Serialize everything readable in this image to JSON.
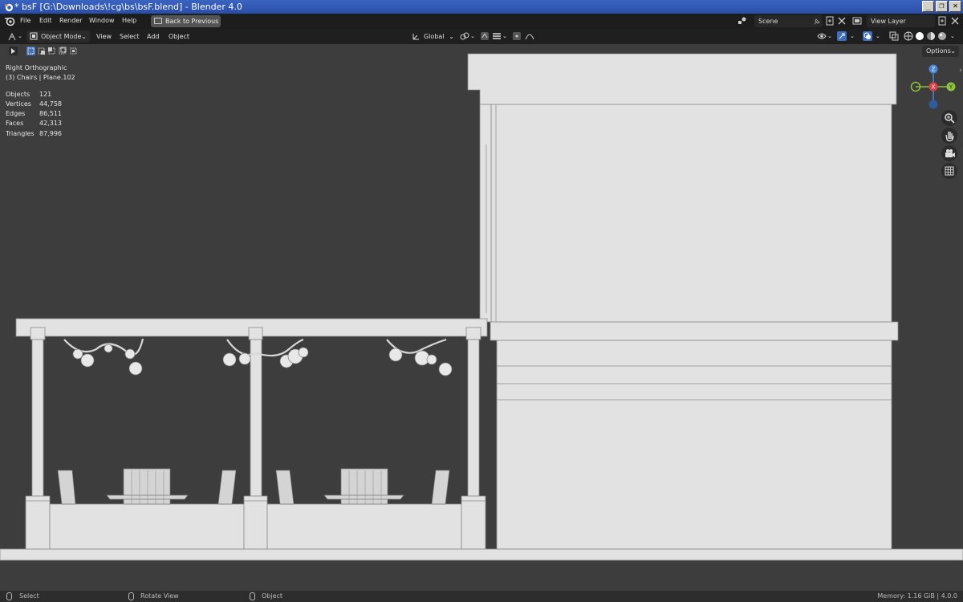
{
  "window": {
    "title": "* bsF [G:\\Downloads\\!cg\\bs\\bsF.blend] - Blender 4.0",
    "buttons": [
      "_",
      "❐",
      "✕"
    ]
  },
  "menubar": {
    "items": [
      "File",
      "Edit",
      "Render",
      "Window",
      "Help"
    ],
    "back_button": "Back to Previous",
    "scene": "Scene",
    "view_layer": "View Layer"
  },
  "header": {
    "mode": "Object Mode",
    "menus": [
      "View",
      "Select",
      "Add",
      "Object"
    ],
    "transform_orientation": "Global"
  },
  "viewport": {
    "view_name": "Right Orthographic",
    "collection_info": "(3) Chairs | Plane.102",
    "stats": [
      {
        "label": "Objects",
        "value": "121"
      },
      {
        "label": "Vertices",
        "value": "44,758"
      },
      {
        "label": "Edges",
        "value": "86,511"
      },
      {
        "label": "Faces",
        "value": "42,313"
      },
      {
        "label": "Triangles",
        "value": "87,996"
      }
    ],
    "options_label": "Options",
    "gizmo": {
      "z": "Z",
      "x": "X",
      "y": "Y"
    }
  },
  "statusbar": {
    "select": "Select",
    "rotate": "Rotate View",
    "object": "Object",
    "memory": "Memory: 1.16 GiB | 4.0.0"
  },
  "colors": {
    "viewport_bg": "#3d3d3d",
    "model_fill": "#e2e2e2",
    "model_line": "#8a8a8a",
    "gizmo_x": "#e0404a",
    "gizmo_y": "#8cc43c",
    "gizmo_z": "#4a86d6"
  }
}
